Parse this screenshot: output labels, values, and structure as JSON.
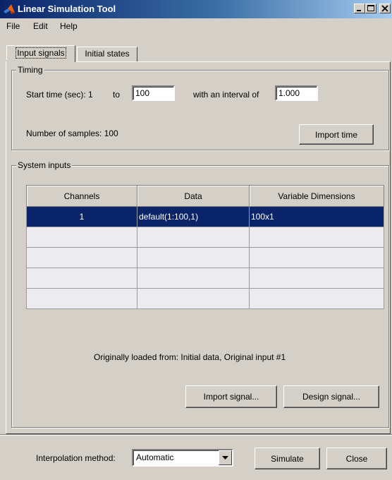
{
  "window": {
    "title": "Linear Simulation Tool",
    "title_bar_color": "#0a246a",
    "icon": "matlab-logo-icon",
    "controls": [
      "minimize-icon",
      "maximize-icon",
      "close-icon"
    ]
  },
  "menu": {
    "items": [
      "File",
      "Edit",
      "Help"
    ]
  },
  "tabs": [
    {
      "label": "Input signals",
      "active": true
    },
    {
      "label": "Initial states",
      "active": false
    }
  ],
  "timing": {
    "group_label": "Timing",
    "start_label": "Start time (sec): 1",
    "to_label": "to",
    "end_time": "100",
    "interval_label": "with an interval of",
    "interval": "1.000",
    "samples_label": "Number of samples: 100",
    "import_time_button": "Import time"
  },
  "system_inputs": {
    "group_label": "System inputs",
    "columns": [
      "Channels",
      "Data",
      "Variable Dimensions"
    ],
    "rows": [
      {
        "channel": "1",
        "data": "default(1:100,1)",
        "dims": "100x1",
        "selected": true
      },
      {
        "channel": "",
        "data": "",
        "dims": "",
        "selected": false
      },
      {
        "channel": "",
        "data": "",
        "dims": "",
        "selected": false
      },
      {
        "channel": "",
        "data": "",
        "dims": "",
        "selected": false
      },
      {
        "channel": "",
        "data": "",
        "dims": "",
        "selected": false
      }
    ],
    "selected_row_color": "#0a246a",
    "origin_text": "Originally loaded from:  Initial data, Original input #1",
    "import_signal_button": "Import signal...",
    "design_signal_button": "Design signal..."
  },
  "footer": {
    "interpolation_label": "Interpolation method:",
    "interpolation_value": "Automatic",
    "simulate_button": "Simulate",
    "close_button": "Close"
  }
}
